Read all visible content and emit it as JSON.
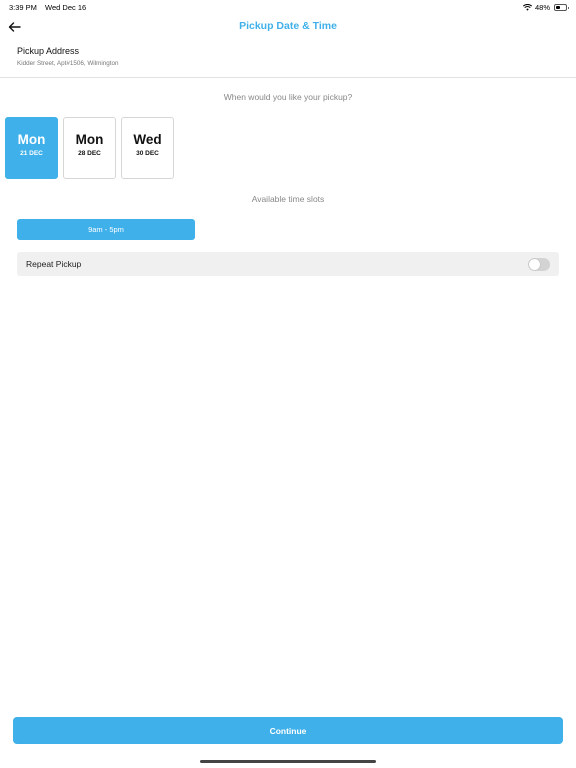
{
  "status_bar": {
    "time": "3:39 PM",
    "date": "Wed Dec 16",
    "battery_text": "48%",
    "battery_level": 0.48
  },
  "nav": {
    "title": "Pickup Date & Time",
    "back_icon": "arrow-left-icon"
  },
  "address": {
    "label": "Pickup Address",
    "value": "Kidder Street, Apt#1506, Wilmington"
  },
  "question": "When would you like your pickup?",
  "dates": [
    {
      "day": "Mon",
      "date": "21 DEC",
      "selected": true
    },
    {
      "day": "Mon",
      "date": "28 DEC",
      "selected": false
    },
    {
      "day": "Wed",
      "date": "30 DEC",
      "selected": false
    }
  ],
  "slots": {
    "label": "Available time slots",
    "items": [
      "9am - 5pm"
    ]
  },
  "repeat": {
    "label": "Repeat Pickup",
    "enabled": false
  },
  "continue_label": "Continue",
  "colors": {
    "accent": "#3fb0ea",
    "row_bg": "#f0f0f0"
  }
}
